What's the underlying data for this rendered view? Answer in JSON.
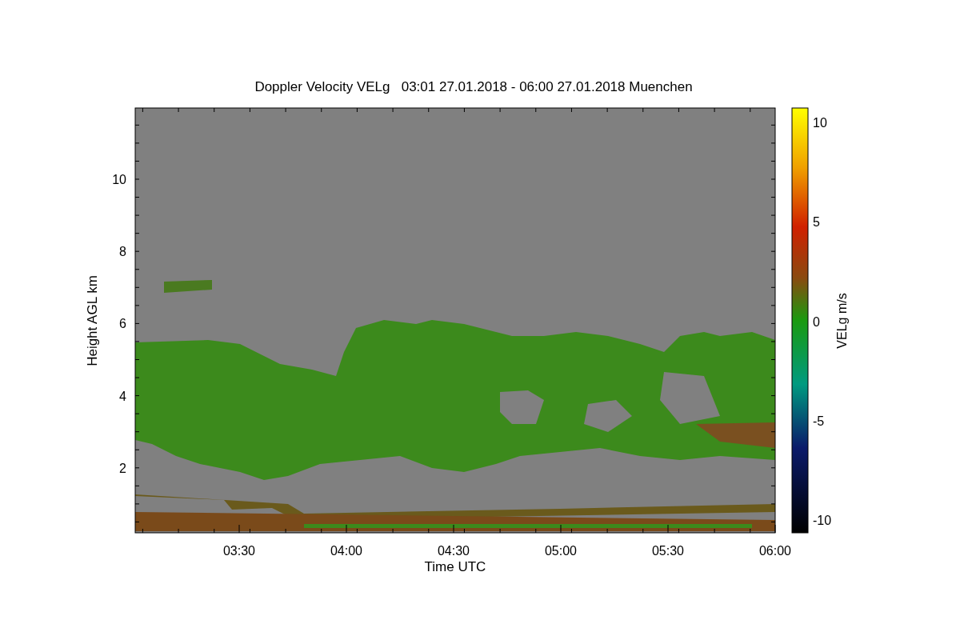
{
  "figure": {
    "title": "Doppler Velocity VELg   03:01 27.01.2018 - 06:00 27.01.2018 Muenchen",
    "xlabel": "Time UTC",
    "ylabel": "Height AGL km",
    "xticks": [
      "03:30",
      "04:00",
      "04:30",
      "05:00",
      "05:30",
      "06:00"
    ],
    "yticks": [
      "10",
      "8",
      "6",
      "4",
      "2"
    ],
    "colorbar": {
      "label": "VELg m/s",
      "ticks": [
        "10",
        "5",
        "0",
        "-5",
        "-10"
      ]
    }
  }
}
